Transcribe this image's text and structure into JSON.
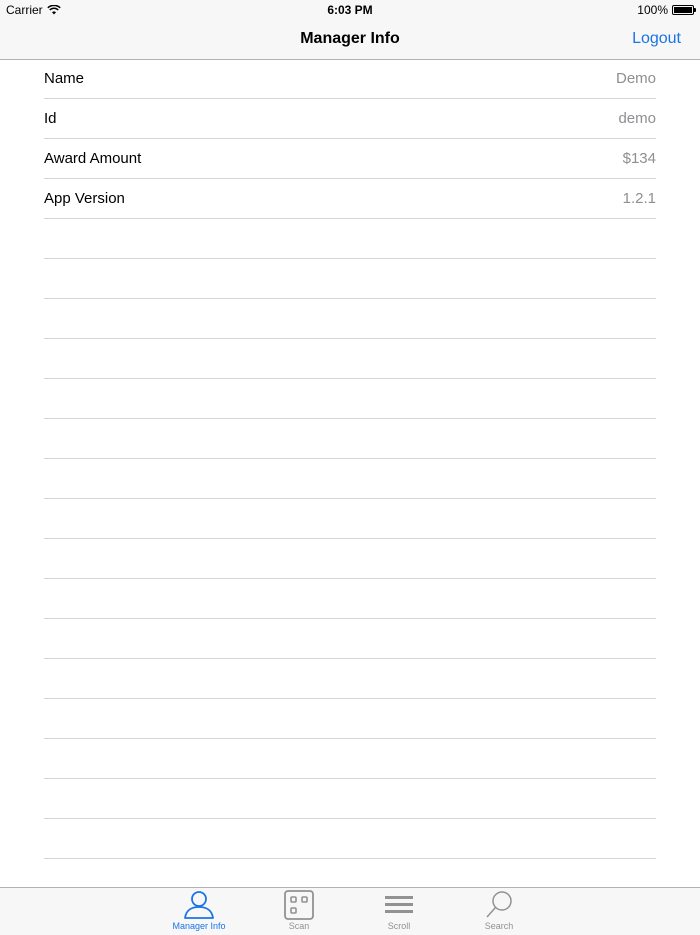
{
  "status_bar": {
    "carrier": "Carrier",
    "time": "6:03 PM",
    "battery": "100%",
    "battery_level": 1.0
  },
  "nav": {
    "title": "Manager Info",
    "logout_label": "Logout"
  },
  "info_rows": [
    {
      "label": "Name",
      "value": "Demo"
    },
    {
      "label": "Id",
      "value": "demo"
    },
    {
      "label": "Award Amount",
      "value": "$134"
    },
    {
      "label": "App Version",
      "value": "1.2.1"
    }
  ],
  "tab_bar": {
    "active_color": "#1a74e8",
    "inactive_color": "#929292",
    "tabs": [
      {
        "label": "Manager Info",
        "icon": "person-icon",
        "active": true
      },
      {
        "label": "Scan",
        "icon": "scan-icon",
        "active": false
      },
      {
        "label": "Scroll",
        "icon": "menu-lines-icon",
        "active": false
      },
      {
        "label": "Search",
        "icon": "search-icon",
        "active": false
      }
    ]
  }
}
